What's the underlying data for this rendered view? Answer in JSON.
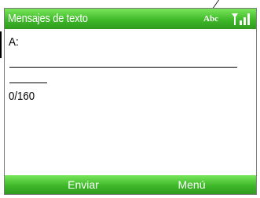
{
  "header": {
    "title": "Mensajes de texto",
    "input_mode": "Abc",
    "signal_icon": "signal-strength-icon"
  },
  "compose": {
    "to_label": "A:",
    "to_value": "",
    "char_counter": "0/160"
  },
  "softkeys": {
    "left": "Enviar",
    "right": "Menú"
  },
  "colors": {
    "bar_green": "#3fb82a",
    "text_on_bar": "#ffffff"
  }
}
